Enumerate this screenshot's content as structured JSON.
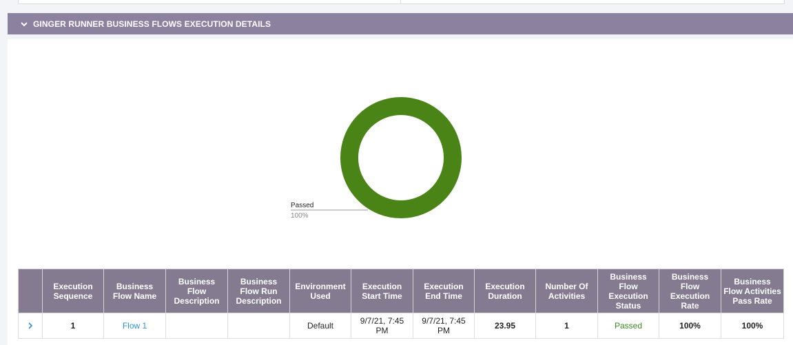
{
  "section": {
    "title": "GINGER RUNNER BUSINESS FLOWS EXECUTION DETAILS",
    "chevron_icon": "chevron-down-icon"
  },
  "chart_data": {
    "type": "pie",
    "categories": [
      "Passed"
    ],
    "values": [
      100
    ],
    "labels": [
      {
        "name": "Passed",
        "value_text": "100%"
      }
    ],
    "colors": [
      "#4a8417"
    ]
  },
  "table": {
    "headers": [
      "",
      "Execution Sequence",
      "Business Flow Name",
      "Business Flow Description",
      "Business Flow Run Description",
      "Environment Used",
      "Execution Start Time",
      "Execution End Time",
      "Execution Duration",
      "Number Of Activities",
      "Business Flow Execution Status",
      "Business Flow Execution Rate",
      "Business Flow Activities Pass Rate"
    ],
    "rows": [
      {
        "expand_icon": "chevron-right-icon",
        "sequence": "1",
        "flow_name": "Flow 1",
        "description": "",
        "run_description": "",
        "environment": "Default",
        "start_time": "9/7/21, 7:45 PM",
        "end_time": "9/7/21, 7:45 PM",
        "duration": "23.95",
        "activities": "1",
        "status": "Passed",
        "execution_rate": "100%",
        "pass_rate": "100%"
      }
    ]
  }
}
